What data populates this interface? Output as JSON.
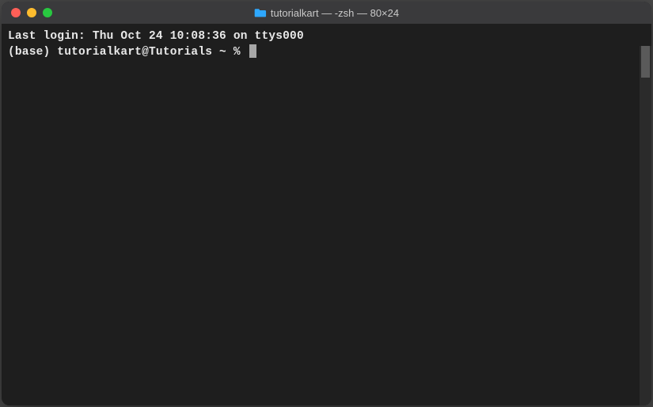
{
  "window": {
    "title": "tutorialkart — -zsh — 80×24"
  },
  "terminal": {
    "last_login": "Last login: Thu Oct 24 10:08:36 on ttys000",
    "prompt": "(base) tutorialkart@Tutorials ~ % "
  }
}
